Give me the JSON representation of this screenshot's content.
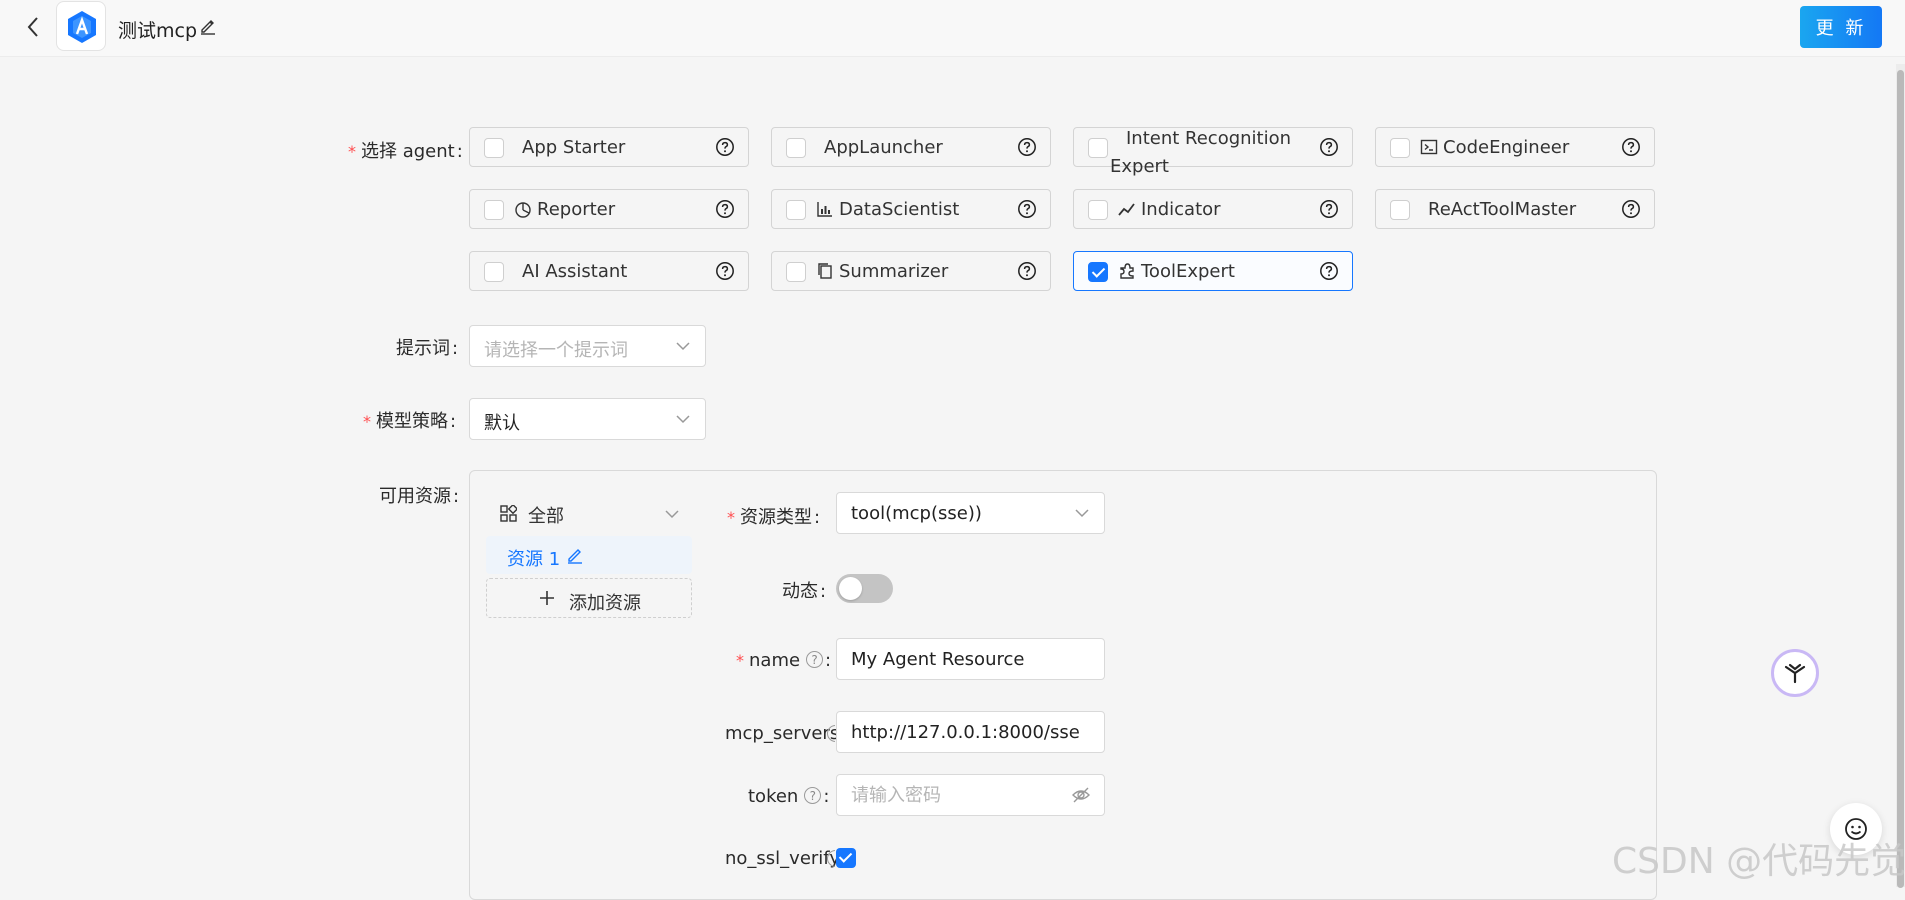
{
  "header": {
    "title": "测试mcp",
    "update_label": "更 新"
  },
  "agent_field": {
    "label": "选择 agent",
    "agents": [
      {
        "label": "App Starter",
        "icon": "",
        "checked": false
      },
      {
        "label": "AppLauncher",
        "icon": "",
        "checked": false
      },
      {
        "label": "Intent Recognition Expert",
        "icon": "",
        "checked": false
      },
      {
        "label": "CodeEngineer",
        "icon": "terminal-icon",
        "checked": false
      },
      {
        "label": "Reporter",
        "icon": "pie-chart-icon",
        "checked": false
      },
      {
        "label": "DataScientist",
        "icon": "bar-chart-icon",
        "checked": false
      },
      {
        "label": "Indicator",
        "icon": "line-chart-icon",
        "checked": false
      },
      {
        "label": "ReActToolMaster",
        "icon": "",
        "checked": false
      },
      {
        "label": "AI Assistant",
        "icon": "",
        "checked": false
      },
      {
        "label": "Summarizer",
        "icon": "copy-icon",
        "checked": false
      },
      {
        "label": "ToolExpert",
        "icon": "puzzle-icon",
        "checked": true
      }
    ]
  },
  "prompt_field": {
    "label": "提示词",
    "placeholder": "请选择一个提示词"
  },
  "model_field": {
    "label": "模型策略",
    "value": "默认"
  },
  "resources": {
    "label": "可用资源",
    "filter_label": "全部",
    "items": [
      {
        "label": "资源 1"
      }
    ],
    "add_label": "添加资源",
    "type_label": "资源类型",
    "type_value": "tool(mcp(sse))",
    "dynamic_label": "动态",
    "dynamic_on": false,
    "name_label": "name",
    "name_value": "My Agent Resource",
    "mcp_label": "mcp_servers",
    "mcp_value": "http://127.0.0.1:8000/sse",
    "token_label": "token",
    "token_placeholder": "请输入密码",
    "ssl_label": "no_ssl_verify",
    "ssl_checked": true
  },
  "watermark": "CSDN @代码先觉",
  "colors": {
    "primary": "#1677ff",
    "required": "#ff4d4f",
    "update_gradient_start": "#1aa6f0"
  }
}
